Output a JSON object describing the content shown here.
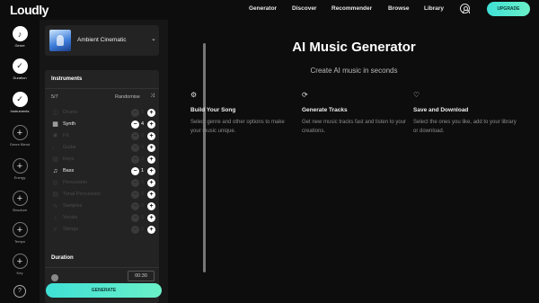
{
  "brand": {
    "logo": "Loudly"
  },
  "nav": {
    "items": [
      "Generator",
      "Discover",
      "Recommender",
      "Browse",
      "Library"
    ],
    "upgrade": "UPGRADE",
    "account_icon": "account-circle-icon"
  },
  "steps": [
    {
      "label": "Genre",
      "state": "active",
      "icon": "music-note-icon"
    },
    {
      "label": "Duration",
      "state": "done",
      "icon": "check-icon"
    },
    {
      "label": "Instruments",
      "state": "done",
      "icon": "check-icon"
    },
    {
      "label": "Genre Blend",
      "state": "todo",
      "icon": "plus-icon"
    },
    {
      "label": "Energy",
      "state": "todo",
      "icon": "plus-icon"
    },
    {
      "label": "Structure",
      "state": "todo",
      "icon": "plus-icon"
    },
    {
      "label": "Tempo",
      "state": "todo",
      "icon": "plus-icon"
    },
    {
      "label": "Key",
      "state": "todo",
      "icon": "plus-icon"
    }
  ],
  "genre": {
    "name": "Ambient Cinematic",
    "thumb_text": "Ambient"
  },
  "instruments": {
    "title": "Instruments",
    "count": "5/7",
    "randomise": "Randomise",
    "items": [
      {
        "name": "Drums",
        "value": "0",
        "enabled": false,
        "icon": "drums-icon"
      },
      {
        "name": "Synth",
        "value": "4",
        "enabled": true,
        "icon": "synth-icon"
      },
      {
        "name": "FX",
        "value": "0",
        "enabled": false,
        "icon": "fx-icon"
      },
      {
        "name": "Guitar",
        "value": "0",
        "enabled": false,
        "icon": "guitar-icon"
      },
      {
        "name": "Keys",
        "value": "0",
        "enabled": false,
        "icon": "keys-icon"
      },
      {
        "name": "Bass",
        "value": "1",
        "enabled": true,
        "icon": "bass-guitar-icon"
      },
      {
        "name": "Percussion",
        "value": "0",
        "enabled": false,
        "icon": "percussion-icon"
      },
      {
        "name": "Tonal Percussion",
        "value": "0",
        "enabled": false,
        "icon": "tonal-percussion-icon"
      },
      {
        "name": "Samples",
        "value": "0",
        "enabled": false,
        "icon": "samples-icon"
      },
      {
        "name": "Vocals",
        "value": "0",
        "enabled": false,
        "icon": "microphone-icon"
      },
      {
        "name": "Strings",
        "value": "0",
        "enabled": false,
        "icon": "strings-icon"
      }
    ]
  },
  "duration": {
    "title": "Duration",
    "time": "00:30"
  },
  "generate": "GENERATE",
  "main": {
    "title": "AI Music Generator",
    "subtitle": "Create AI music in seconds",
    "features": [
      {
        "title": "Build Your Song",
        "desc": "Select genre and other options to make your music unique.",
        "icon": "build-icon"
      },
      {
        "title": "Generate Tracks",
        "desc": "Get new music tracks fast and listen to your creations.",
        "icon": "refresh-icon"
      },
      {
        "title": "Save and Download",
        "desc": "Select the ones you like, add to your library or download.",
        "icon": "heart-plus-icon"
      }
    ]
  },
  "colors": {
    "accent": "#4de6d2",
    "background": "#0d0d0d",
    "panel": "#161616",
    "card": "#232323"
  }
}
